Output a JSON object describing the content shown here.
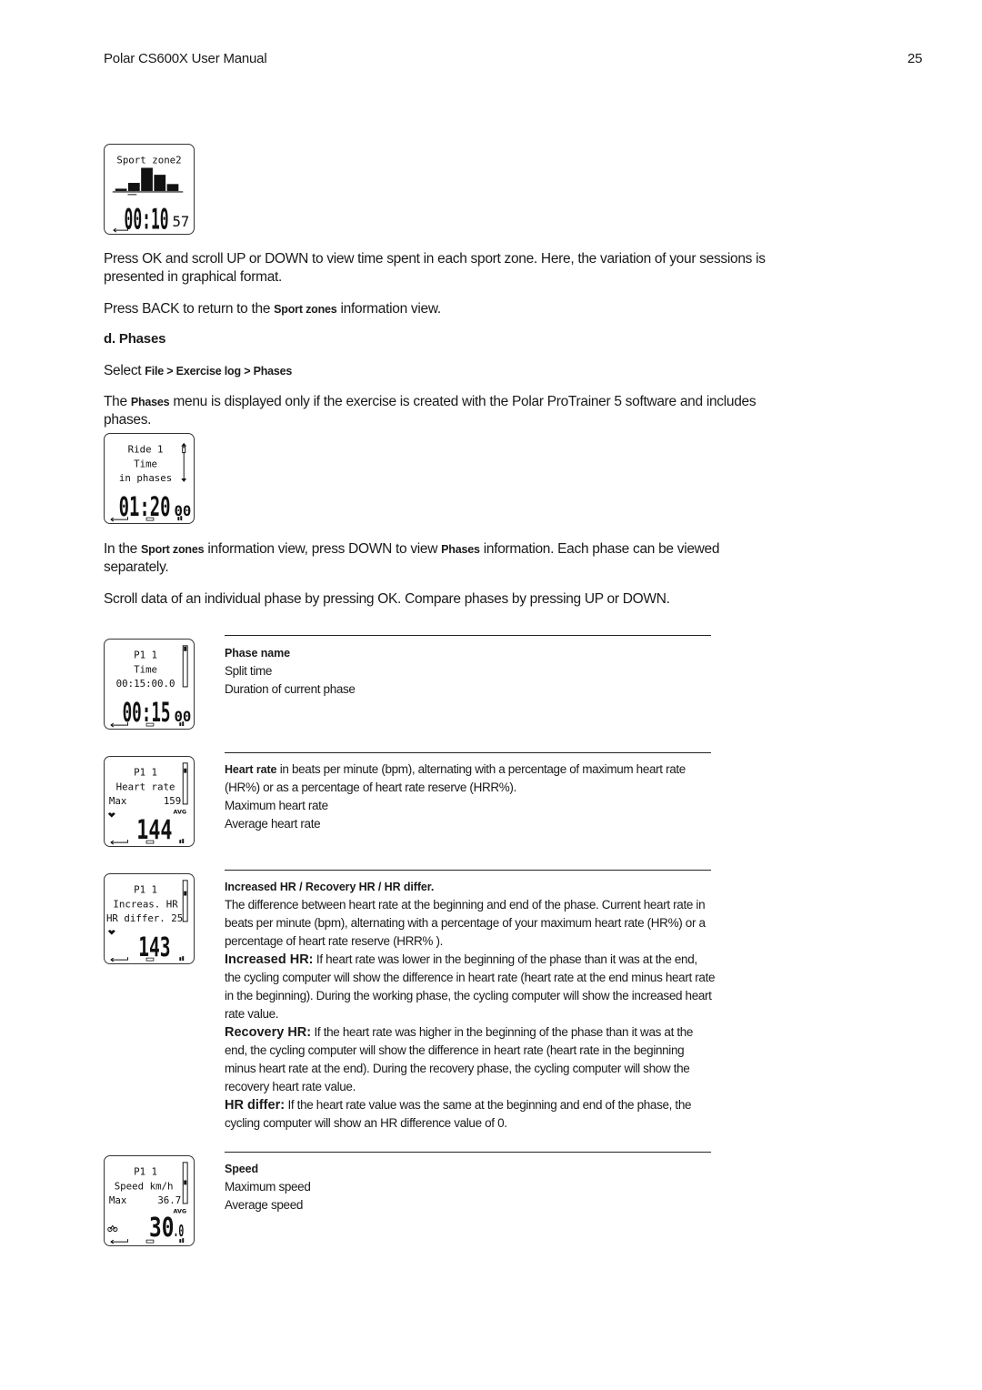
{
  "header": {
    "title": "Polar CS600X User Manual",
    "page_number": "25"
  },
  "devices": {
    "sport_zone": {
      "title": "Sport zone2",
      "histogram": [
        0.1,
        0.35,
        1.0,
        0.7,
        0.3
      ],
      "big": "00:10",
      "small": "57",
      "icons": [
        "back-arrow-icon"
      ]
    },
    "ride": {
      "line1": "Ride 1",
      "line2": "Time",
      "line3": "in phases",
      "big": "01:20",
      "small": "00",
      "icons": [
        "back-arrow-icon",
        "ok-icon",
        "bars-icon",
        "scroll-arrow-icon"
      ]
    },
    "phase_time": {
      "line1": "P1 1",
      "line2": "Time",
      "line3": "00:15:00.0",
      "big": "00:15",
      "small": "00",
      "icons": [
        "back-arrow-icon",
        "ok-icon",
        "bars-icon"
      ]
    },
    "phase_hr": {
      "line1": "P1 1",
      "line2": "Heart rate",
      "line3_label": "Max",
      "line3_value": "159",
      "big": "144",
      "badge": "AVG",
      "icons": [
        "heart-icon",
        "back-arrow-icon",
        "ok-icon",
        "bars-icon"
      ]
    },
    "phase_inc": {
      "line1": "P1 1",
      "line2": "Increas. HR",
      "line3": "HR differ. 25",
      "big": "143",
      "icons": [
        "heart-icon",
        "back-arrow-icon",
        "ok-icon",
        "bars-icon"
      ]
    },
    "phase_speed": {
      "line1": "P1 1",
      "line2": "Speed km/h",
      "line3_label": "Max",
      "line3_value": "36.7",
      "big": "30",
      "big_dec": ".0",
      "badge": "AVG",
      "icons": [
        "bike-icon",
        "back-arrow-icon",
        "ok-icon",
        "bars-icon"
      ]
    }
  },
  "body": {
    "p1": "Press OK and scroll UP or DOWN to view time spent in each sport zone. Here, the variation of your sessions is presented in graphical format.",
    "p2_pre": "Press BACK to return to the ",
    "p2_ui": "Sport zones",
    "p2_post": " information view.",
    "section_heading": "d. Phases",
    "p3_pre": "Select ",
    "p3_ui": "File > Exercise log > Phases",
    "p4_pre": "The ",
    "p4_ui": "Phases",
    "p4_post": " menu is displayed only if the exercise is created with the Polar ProTrainer 5 software and includes phases.",
    "p5_pre": "In the ",
    "p5_ui1": "Sport zones",
    "p5_mid": " information view, press DOWN to view ",
    "p5_ui2": "Phases",
    "p5_post": " information. Each phase can be viewed separately.",
    "p6": "Scroll data of an individual phase by pressing OK. Compare phases by pressing UP or DOWN."
  },
  "table": {
    "row1": {
      "title": "Phase name",
      "lines": [
        "Split time",
        "Duration of current phase"
      ]
    },
    "row2": {
      "title": "Heart rate",
      "title_rest": " in beats per minute (bpm), alternating with a percentage of maximum heart rate (HR%) or as a percentage of heart rate reserve (HRR%).",
      "lines": [
        "Maximum heart rate",
        "Average heart rate"
      ]
    },
    "row3": {
      "title": "Increased HR / Recovery HR / HR differ.",
      "intro": "The difference between heart rate at the beginning and end of the phase. Current heart rate in beats per minute (bpm), alternating with a percentage of your maximum heart rate (HR%) or a percentage of heart rate reserve (HRR% ).",
      "inc_label": "Increased HR:",
      "inc_text": " If heart rate was lower in the beginning of the phase than it was at the end, the cycling computer will show the difference in heart rate (heart rate at the end minus heart rate in the beginning). During the working phase, the cycling computer will show the increased heart rate value.",
      "rec_label": "Recovery HR:",
      "rec_text": " If the heart rate was higher in the beginning of the phase than it was at the end, the cycling computer will show the difference in heart rate (heart rate in the beginning minus heart rate at the end). During the recovery phase, the cycling computer will show the recovery heart rate value.",
      "diff_label": "HR differ:",
      "diff_text": " If the heart rate value was the same at the beginning and end of the phase, the cycling computer will show an HR difference value of 0."
    },
    "row4": {
      "title": "Speed",
      "lines": [
        "Maximum speed",
        "Average speed"
      ]
    }
  }
}
